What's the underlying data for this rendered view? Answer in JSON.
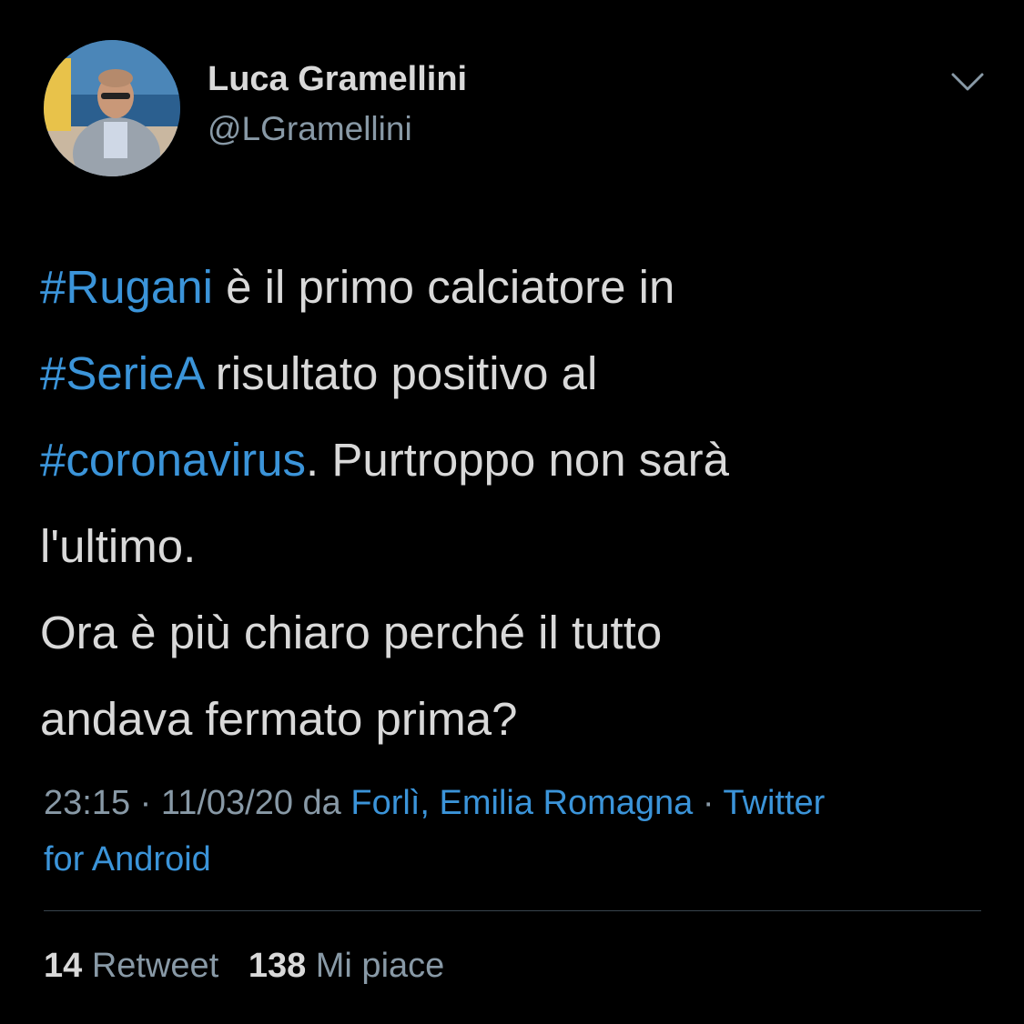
{
  "author": {
    "display_name": "Luca Gramellini",
    "handle": "@LGramellini"
  },
  "tweet": {
    "lines": [
      [
        {
          "text": "#Rugani",
          "hashtag": true
        },
        {
          "text": " è il primo calciatore in",
          "hashtag": false
        }
      ],
      [
        {
          "text": "#SerieA",
          "hashtag": true
        },
        {
          "text": " risultato positivo al",
          "hashtag": false
        }
      ],
      [
        {
          "text": "#coronavirus",
          "hashtag": true
        },
        {
          "text": ". Purtroppo non sarà",
          "hashtag": false
        }
      ],
      [
        {
          "text": "l'ultimo.",
          "hashtag": false
        }
      ],
      [
        {
          "text": "Ora è più chiaro perché il tutto",
          "hashtag": false
        }
      ],
      [
        {
          "text": "andava fermato prima?",
          "hashtag": false
        }
      ]
    ]
  },
  "meta": {
    "time": "23:15",
    "separator": "·",
    "date": "11/03/20",
    "via_word": "da",
    "location": "Forlì, Emilia Romagna",
    "client_line1": "Twitter",
    "client_line2": "for Android"
  },
  "stats": {
    "retweets_count": "14",
    "retweets_label": "Retweet",
    "likes_count": "138",
    "likes_label": "Mi piace"
  },
  "icons": {
    "menu": "chevron-down-icon"
  },
  "colors": {
    "background": "#000000",
    "text": "#d9d9d9",
    "secondary": "#8899a6",
    "link": "#3b94d9",
    "divider": "#38444d"
  }
}
